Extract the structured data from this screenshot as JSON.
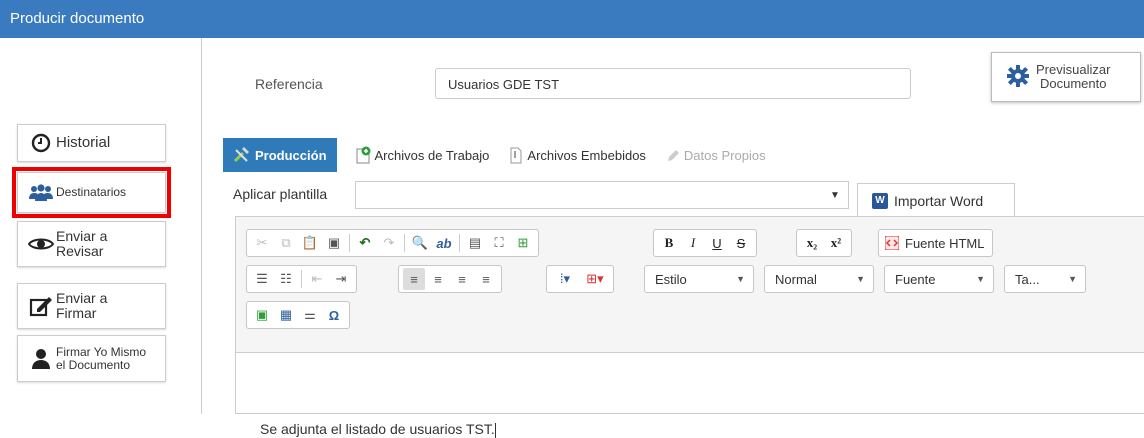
{
  "window": {
    "title": "Producir documento"
  },
  "sidebar": {
    "items": [
      {
        "label": "Historial",
        "icon": "clock-icon"
      },
      {
        "label": "Destinatarios",
        "icon": "users-icon"
      },
      {
        "label": "Enviar a\nRevisar",
        "icon": "eye-icon"
      },
      {
        "label": "Enviar a\nFirmar",
        "icon": "sign-icon"
      },
      {
        "label": "Firmar Yo Mismo\nel Documento",
        "icon": "user-icon"
      }
    ]
  },
  "form": {
    "referencia_label": "Referencia",
    "referencia_value": "Usuarios GDE TST",
    "preview_label": "Previsualizar\nDocumento"
  },
  "tabs": [
    {
      "label": "Producción",
      "active": true
    },
    {
      "label": "Archivos de Trabajo"
    },
    {
      "label": "Archivos Embebidos"
    },
    {
      "label": "Datos Propios",
      "disabled": true
    }
  ],
  "plantilla": {
    "label": "Aplicar plantilla",
    "value": ""
  },
  "import_word": {
    "label": "Importar Word",
    "icon_text": "W"
  },
  "toolbar": {
    "fuente_html": "Fuente HTML",
    "estilo": "Estilo",
    "normal": "Normal",
    "fuente": "Fuente",
    "tamano": "Ta..."
  },
  "editor": {
    "content": "Se adjunta el listado de usuarios TST."
  },
  "colors": {
    "titlebar": "#3a7bc0",
    "tab_active": "#2f7ab8",
    "highlight": "#e00000"
  }
}
